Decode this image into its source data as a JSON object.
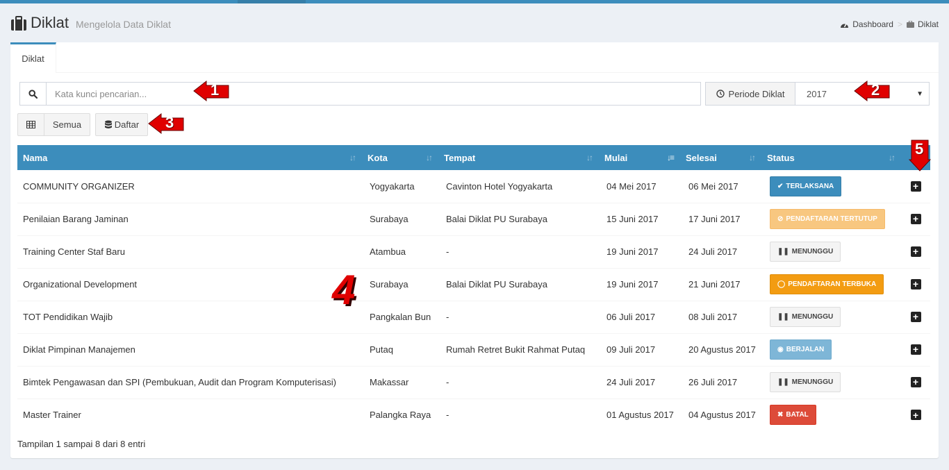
{
  "header": {
    "title": "Diklat",
    "subtitle": "Mengelola Data Diklat",
    "breadcrumb": [
      "Dashboard",
      "Diklat"
    ]
  },
  "tab": {
    "label": "Diklat"
  },
  "search": {
    "placeholder": "Kata kunci pencarian..."
  },
  "periode": {
    "label": "Periode Diklat",
    "value": "2017"
  },
  "view_buttons": {
    "semua": "Semua",
    "daftar": "Daftar"
  },
  "table": {
    "columns": [
      "Nama",
      "Kota",
      "Tempat",
      "Mulai",
      "Selesai",
      "Status"
    ],
    "rows": [
      {
        "nama": "COMMUNITY ORGANIZER",
        "kota": "Yogyakarta",
        "tempat": "Cavinton Hotel Yogyakarta",
        "mulai": "04 Mei 2017",
        "selesai": "06 Mei 2017",
        "status": "TERLAKSANA"
      },
      {
        "nama": "Penilaian Barang Jaminan",
        "kota": "Surabaya",
        "tempat": "Balai Diklat PU Surabaya",
        "mulai": "15 Juni 2017",
        "selesai": "17 Juni 2017",
        "status": "PENDAFTARAN TERTUTUP"
      },
      {
        "nama": "Training Center Staf Baru",
        "kota": "Atambua",
        "tempat": "-",
        "mulai": "19 Juni 2017",
        "selesai": "24 Juli 2017",
        "status": "MENUNGGU"
      },
      {
        "nama": "Organizational Development",
        "kota": "Surabaya",
        "tempat": "Balai Diklat PU Surabaya",
        "mulai": "19 Juni 2017",
        "selesai": "21 Juni 2017",
        "status": "PENDAFTARAN TERBUKA"
      },
      {
        "nama": "TOT Pendidikan Wajib",
        "kota": "Pangkalan Bun",
        "tempat": "-",
        "mulai": "06 Juli 2017",
        "selesai": "08 Juli 2017",
        "status": "MENUNGGU"
      },
      {
        "nama": "Diklat Pimpinan Manajemen",
        "kota": "Putaq",
        "tempat": "Rumah Retret Bukit Rahmat Putaq",
        "mulai": "09 Juli 2017",
        "selesai": "20 Agustus 2017",
        "status": "BERJALAN"
      },
      {
        "nama": "Bimtek Pengawasan dan SPI (Pembukuan, Audit dan Program Komputerisasi)",
        "kota": "Makassar",
        "tempat": "-",
        "mulai": "24 Juli 2017",
        "selesai": "26 Juli 2017",
        "status": "MENUNGGU"
      },
      {
        "nama": "Master Trainer",
        "kota": "Palangka Raya",
        "tempat": "-",
        "mulai": "01 Agustus 2017",
        "selesai": "04 Agustus 2017",
        "status": "BATAL"
      }
    ]
  },
  "info": "Tampilan 1 sampai 8 dari 8 entri",
  "callouts": [
    "1",
    "2",
    "3",
    "4",
    "5"
  ],
  "colors": {
    "primary": "#3c8dbc",
    "warning": "#f39c12",
    "danger": "#dd4b39",
    "callout": "#e00000"
  }
}
